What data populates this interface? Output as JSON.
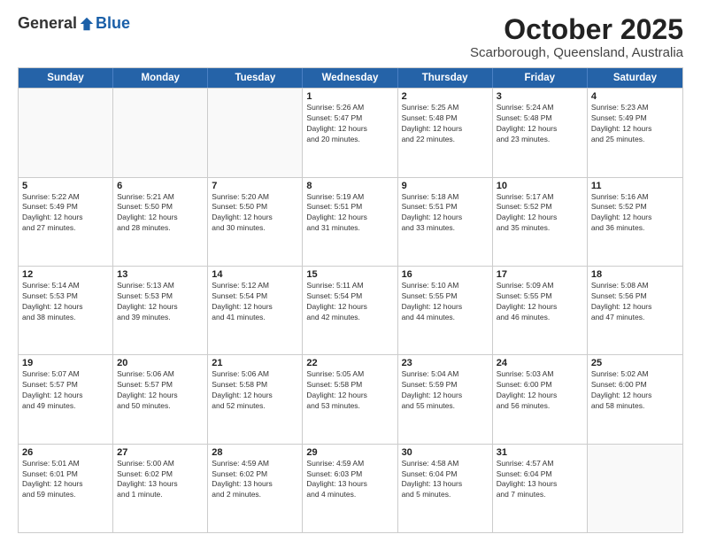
{
  "logo": {
    "general": "General",
    "blue": "Blue"
  },
  "title": "October 2025",
  "location": "Scarborough, Queensland, Australia",
  "weekdays": [
    "Sunday",
    "Monday",
    "Tuesday",
    "Wednesday",
    "Thursday",
    "Friday",
    "Saturday"
  ],
  "weeks": [
    [
      {
        "day": "",
        "info": ""
      },
      {
        "day": "",
        "info": ""
      },
      {
        "day": "",
        "info": ""
      },
      {
        "day": "1",
        "info": "Sunrise: 5:26 AM\nSunset: 5:47 PM\nDaylight: 12 hours\nand 20 minutes."
      },
      {
        "day": "2",
        "info": "Sunrise: 5:25 AM\nSunset: 5:48 PM\nDaylight: 12 hours\nand 22 minutes."
      },
      {
        "day": "3",
        "info": "Sunrise: 5:24 AM\nSunset: 5:48 PM\nDaylight: 12 hours\nand 23 minutes."
      },
      {
        "day": "4",
        "info": "Sunrise: 5:23 AM\nSunset: 5:49 PM\nDaylight: 12 hours\nand 25 minutes."
      }
    ],
    [
      {
        "day": "5",
        "info": "Sunrise: 5:22 AM\nSunset: 5:49 PM\nDaylight: 12 hours\nand 27 minutes."
      },
      {
        "day": "6",
        "info": "Sunrise: 5:21 AM\nSunset: 5:50 PM\nDaylight: 12 hours\nand 28 minutes."
      },
      {
        "day": "7",
        "info": "Sunrise: 5:20 AM\nSunset: 5:50 PM\nDaylight: 12 hours\nand 30 minutes."
      },
      {
        "day": "8",
        "info": "Sunrise: 5:19 AM\nSunset: 5:51 PM\nDaylight: 12 hours\nand 31 minutes."
      },
      {
        "day": "9",
        "info": "Sunrise: 5:18 AM\nSunset: 5:51 PM\nDaylight: 12 hours\nand 33 minutes."
      },
      {
        "day": "10",
        "info": "Sunrise: 5:17 AM\nSunset: 5:52 PM\nDaylight: 12 hours\nand 35 minutes."
      },
      {
        "day": "11",
        "info": "Sunrise: 5:16 AM\nSunset: 5:52 PM\nDaylight: 12 hours\nand 36 minutes."
      }
    ],
    [
      {
        "day": "12",
        "info": "Sunrise: 5:14 AM\nSunset: 5:53 PM\nDaylight: 12 hours\nand 38 minutes."
      },
      {
        "day": "13",
        "info": "Sunrise: 5:13 AM\nSunset: 5:53 PM\nDaylight: 12 hours\nand 39 minutes."
      },
      {
        "day": "14",
        "info": "Sunrise: 5:12 AM\nSunset: 5:54 PM\nDaylight: 12 hours\nand 41 minutes."
      },
      {
        "day": "15",
        "info": "Sunrise: 5:11 AM\nSunset: 5:54 PM\nDaylight: 12 hours\nand 42 minutes."
      },
      {
        "day": "16",
        "info": "Sunrise: 5:10 AM\nSunset: 5:55 PM\nDaylight: 12 hours\nand 44 minutes."
      },
      {
        "day": "17",
        "info": "Sunrise: 5:09 AM\nSunset: 5:55 PM\nDaylight: 12 hours\nand 46 minutes."
      },
      {
        "day": "18",
        "info": "Sunrise: 5:08 AM\nSunset: 5:56 PM\nDaylight: 12 hours\nand 47 minutes."
      }
    ],
    [
      {
        "day": "19",
        "info": "Sunrise: 5:07 AM\nSunset: 5:57 PM\nDaylight: 12 hours\nand 49 minutes."
      },
      {
        "day": "20",
        "info": "Sunrise: 5:06 AM\nSunset: 5:57 PM\nDaylight: 12 hours\nand 50 minutes."
      },
      {
        "day": "21",
        "info": "Sunrise: 5:06 AM\nSunset: 5:58 PM\nDaylight: 12 hours\nand 52 minutes."
      },
      {
        "day": "22",
        "info": "Sunrise: 5:05 AM\nSunset: 5:58 PM\nDaylight: 12 hours\nand 53 minutes."
      },
      {
        "day": "23",
        "info": "Sunrise: 5:04 AM\nSunset: 5:59 PM\nDaylight: 12 hours\nand 55 minutes."
      },
      {
        "day": "24",
        "info": "Sunrise: 5:03 AM\nSunset: 6:00 PM\nDaylight: 12 hours\nand 56 minutes."
      },
      {
        "day": "25",
        "info": "Sunrise: 5:02 AM\nSunset: 6:00 PM\nDaylight: 12 hours\nand 58 minutes."
      }
    ],
    [
      {
        "day": "26",
        "info": "Sunrise: 5:01 AM\nSunset: 6:01 PM\nDaylight: 12 hours\nand 59 minutes."
      },
      {
        "day": "27",
        "info": "Sunrise: 5:00 AM\nSunset: 6:02 PM\nDaylight: 13 hours\nand 1 minute."
      },
      {
        "day": "28",
        "info": "Sunrise: 4:59 AM\nSunset: 6:02 PM\nDaylight: 13 hours\nand 2 minutes."
      },
      {
        "day": "29",
        "info": "Sunrise: 4:59 AM\nSunset: 6:03 PM\nDaylight: 13 hours\nand 4 minutes."
      },
      {
        "day": "30",
        "info": "Sunrise: 4:58 AM\nSunset: 6:04 PM\nDaylight: 13 hours\nand 5 minutes."
      },
      {
        "day": "31",
        "info": "Sunrise: 4:57 AM\nSunset: 6:04 PM\nDaylight: 13 hours\nand 7 minutes."
      },
      {
        "day": "",
        "info": ""
      }
    ]
  ]
}
